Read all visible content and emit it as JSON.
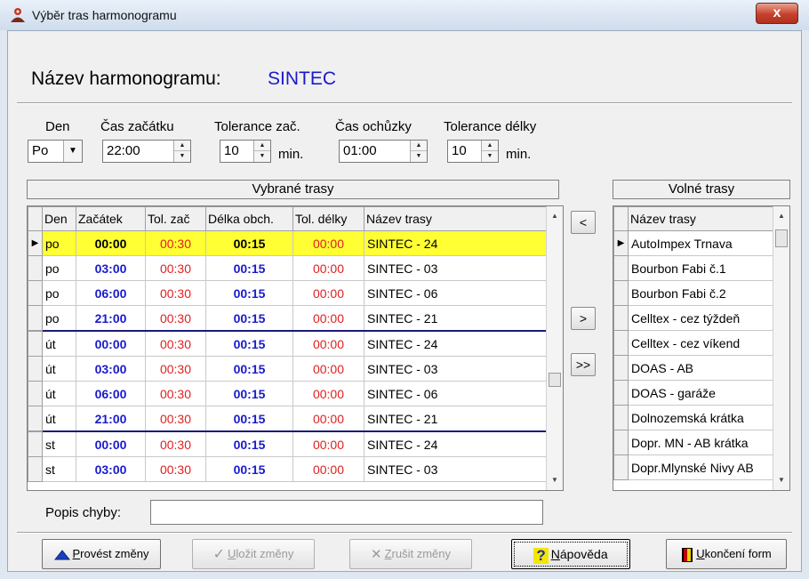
{
  "window": {
    "title": "Výběr tras harmonogramu",
    "close_label": "x"
  },
  "header": {
    "label": "Název harmonogramu:",
    "value": "SINTEC"
  },
  "fields": {
    "den": {
      "label": "Den",
      "value": "Po"
    },
    "cas_zacatku": {
      "label": "Čas začátku",
      "value": "22:00"
    },
    "tolerance_zac": {
      "label": "Tolerance zač.",
      "value": "10",
      "unit": "min."
    },
    "cas_ochuzky": {
      "label": "Čas ochůzky",
      "value": "01:00"
    },
    "tolerance_delky": {
      "label": "Tolerance délky",
      "value": "10",
      "unit": "min."
    }
  },
  "vybrane": {
    "title": "Vybrané trasy",
    "columns": [
      "Den",
      "Začátek",
      "Tol. zač",
      "Délka obch.",
      "Tol. délky",
      "Název trasy"
    ],
    "rows": [
      {
        "den": "po",
        "zacatek": "00:00",
        "tol_zac": "00:30",
        "delka": "00:15",
        "tol_delky": "00:00",
        "nazev": "SINTEC - 24"
      },
      {
        "den": "po",
        "zacatek": "03:00",
        "tol_zac": "00:30",
        "delka": "00:15",
        "tol_delky": "00:00",
        "nazev": "SINTEC - 03"
      },
      {
        "den": "po",
        "zacatek": "06:00",
        "tol_zac": "00:30",
        "delka": "00:15",
        "tol_delky": "00:00",
        "nazev": "SINTEC - 06"
      },
      {
        "den": "po",
        "zacatek": "21:00",
        "tol_zac": "00:30",
        "delka": "00:15",
        "tol_delky": "00:00",
        "nazev": "SINTEC - 21"
      },
      {
        "den": "út",
        "zacatek": "00:00",
        "tol_zac": "00:30",
        "delka": "00:15",
        "tol_delky": "00:00",
        "nazev": "SINTEC - 24"
      },
      {
        "den": "út",
        "zacatek": "03:00",
        "tol_zac": "00:30",
        "delka": "00:15",
        "tol_delky": "00:00",
        "nazev": "SINTEC - 03"
      },
      {
        "den": "út",
        "zacatek": "06:00",
        "tol_zac": "00:30",
        "delka": "00:15",
        "tol_delky": "00:00",
        "nazev": "SINTEC - 06"
      },
      {
        "den": "út",
        "zacatek": "21:00",
        "tol_zac": "00:30",
        "delka": "00:15",
        "tol_delky": "00:00",
        "nazev": "SINTEC - 21"
      },
      {
        "den": "st",
        "zacatek": "00:00",
        "tol_zac": "00:30",
        "delka": "00:15",
        "tol_delky": "00:00",
        "nazev": "SINTEC - 24"
      },
      {
        "den": "st",
        "zacatek": "03:00",
        "tol_zac": "00:30",
        "delka": "00:15",
        "tol_delky": "00:00",
        "nazev": "SINTEC - 03"
      }
    ]
  },
  "transfer": {
    "left": "<",
    "right": ">",
    "all_right": ">>"
  },
  "volne": {
    "title": "Volné trasy",
    "column": "Název trasy",
    "rows": [
      "AutoImpex Trnava",
      "Bourbon Fabi č.1",
      "Bourbon Fabi č.2",
      "Celltex - cez týždeň",
      "Celltex - cez víkend",
      "DOAS - AB",
      "DOAS - garáže",
      "Dolnozemská krátka",
      "Dopr. MN - AB krátka",
      "Dopr.Mlynské Nivy AB"
    ]
  },
  "popis": {
    "label": "Popis chyby:",
    "value": ""
  },
  "buttons": {
    "provest": {
      "u": "P",
      "rest": "rovést změny"
    },
    "ulozit": {
      "u": "U",
      "rest": "ložit změny"
    },
    "zrusit": {
      "u": "Z",
      "rest": "rušit změny"
    },
    "napoveda": {
      "u": "N",
      "rest": "ápověda"
    },
    "ukonceni": {
      "u": "U",
      "rest": "končení form"
    }
  },
  "colors": {
    "accent_blue": "#1a1acc",
    "tolerance_red": "#e02020",
    "selected_row": "#ffff33"
  }
}
